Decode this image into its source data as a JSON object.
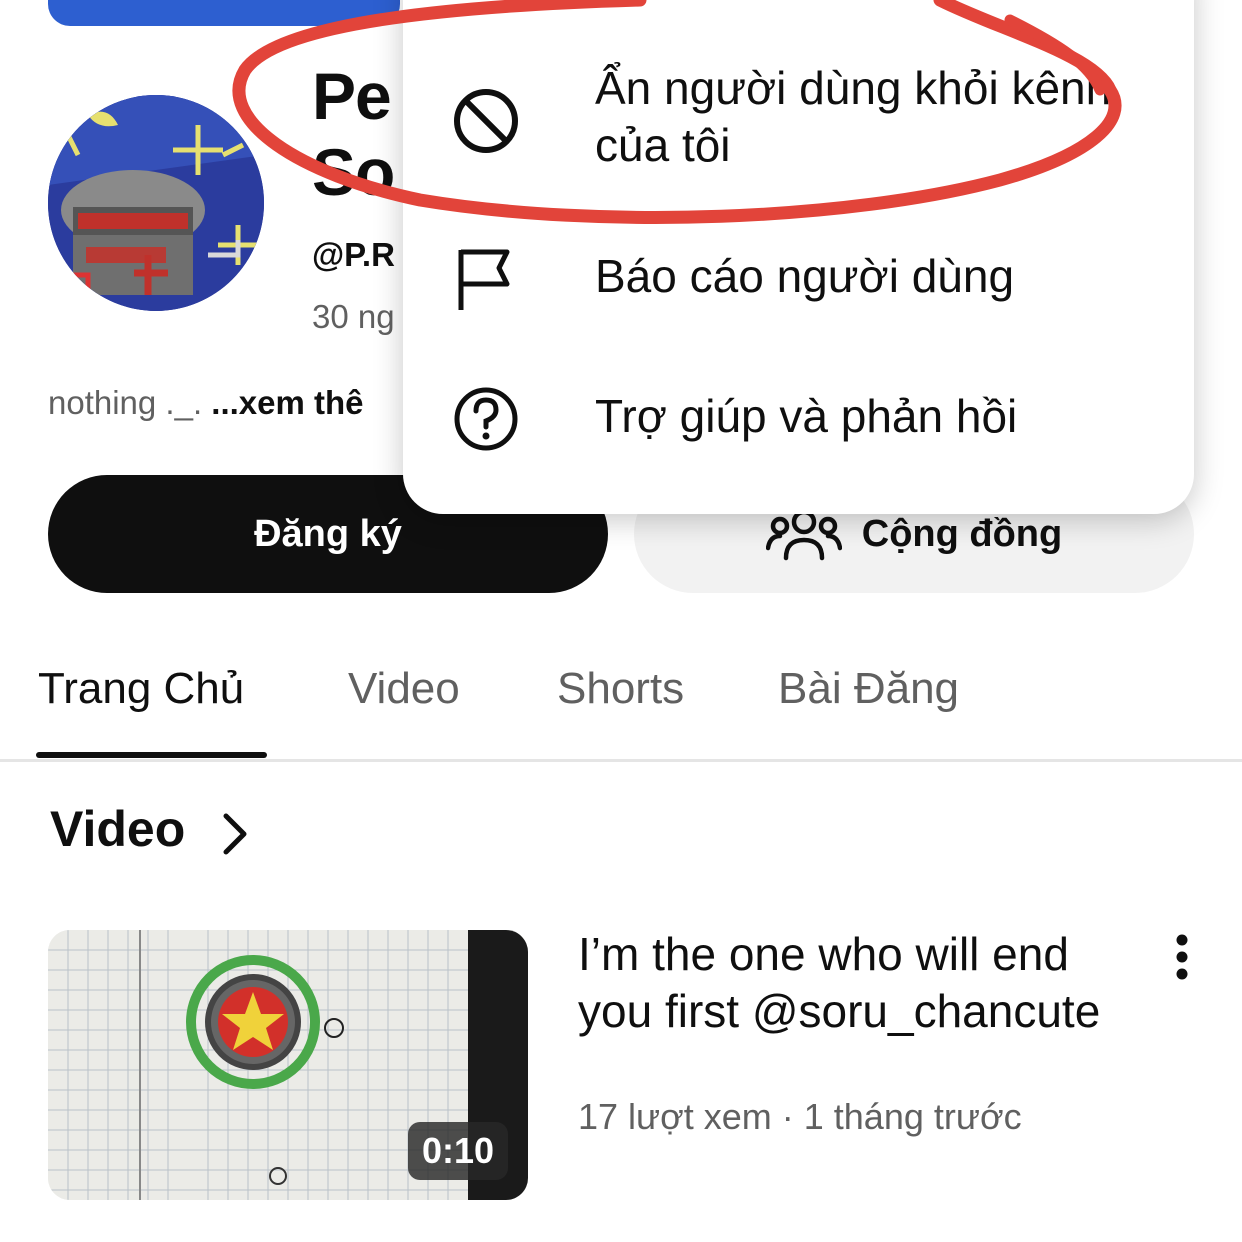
{
  "channel": {
    "name": "Pe\nSo",
    "handle": "@P.R",
    "subscribers": "30 ng",
    "description": "nothing ._. ",
    "description_more": "...xem thê"
  },
  "buttons": {
    "subscribe": "Đăng ký",
    "community": "Cộng đồng"
  },
  "tabs": [
    {
      "label": "Trang Chủ",
      "active": true
    },
    {
      "label": "Video",
      "active": false
    },
    {
      "label": "Shorts",
      "active": false
    },
    {
      "label": "Bài Đăng",
      "active": false
    }
  ],
  "section": {
    "title": "Video"
  },
  "video": {
    "title": "I’m the one who will end you first @soru_chancute",
    "meta": "17 lượt xem · 1 tháng trước",
    "duration": "0:10"
  },
  "menu": {
    "items": [
      {
        "label": "Ẩn người dùng khỏi kênh của tôi",
        "icon": "block-icon"
      },
      {
        "label": "Báo cáo người dùng",
        "icon": "flag-icon"
      },
      {
        "label": "Trợ giúp và phản hồi",
        "icon": "help-icon"
      }
    ]
  },
  "colors": {
    "annotation": "#e2443a",
    "subscribe_bg": "#0f0f0f",
    "secondary_text": "#606060"
  }
}
